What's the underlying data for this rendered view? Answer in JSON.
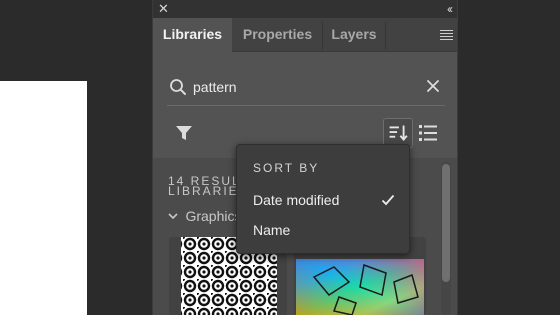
{
  "header": {
    "close_glyph": "✕",
    "collapse_glyph": "‹‹"
  },
  "tabs": [
    {
      "label": "Libraries",
      "active": true
    },
    {
      "label": "Properties",
      "active": false
    },
    {
      "label": "Layers",
      "active": false
    }
  ],
  "search": {
    "value": "pattern",
    "placeholder": "Search"
  },
  "results": {
    "count_text": "14 RESULTS",
    "libraries_text": "LIBRARIES",
    "group_label": "Graphics"
  },
  "sort_menu": {
    "heading": "SORT BY",
    "options": [
      {
        "label": "Date modified",
        "selected": true
      },
      {
        "label": "Name",
        "selected": false
      }
    ]
  },
  "colors": {
    "panel_bg": "#535353",
    "header_bg": "#323232",
    "tab_bar_bg": "#424242",
    "menu_bg": "#3d3d3d",
    "canvas_bg": "#2b2b2b"
  },
  "icons": {
    "close": "close-icon",
    "collapse": "double-chevron-left-icon",
    "panel_menu": "hamburger-icon",
    "search": "search-icon",
    "clear": "clear-icon",
    "filter": "filter-icon",
    "sort": "sort-icon",
    "list_view": "list-view-icon",
    "check": "checkmark-icon",
    "group_chevron": "chevron-down-icon"
  }
}
